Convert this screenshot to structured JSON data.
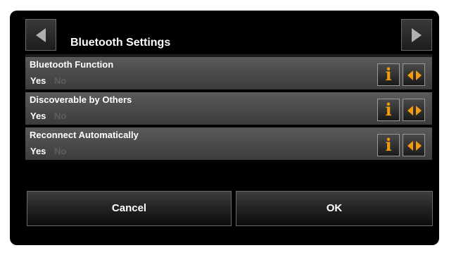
{
  "header": {
    "title": "Bluetooth Settings",
    "prev_icon": "triangle-left-icon",
    "next_icon": "triangle-right-icon"
  },
  "settings": [
    {
      "label": "Bluetooth Function",
      "options": [
        "Yes",
        "No"
      ],
      "selected": "Yes"
    },
    {
      "label": "Discoverable by Others",
      "options": [
        "Yes",
        "No"
      ],
      "selected": "Yes"
    },
    {
      "label": "Reconnect Automatically",
      "options": [
        "Yes",
        "No"
      ],
      "selected": "Yes"
    }
  ],
  "row_buttons": {
    "info_icon": "info-icon",
    "info_glyph": "i",
    "toggle_icon": "toggle-arrows-icon"
  },
  "footer": {
    "cancel_label": "Cancel",
    "ok_label": "OK"
  },
  "colors": {
    "accent": "#f29a10",
    "selected_text": "#ffffff",
    "unselected_text": "#5e5e5e"
  }
}
